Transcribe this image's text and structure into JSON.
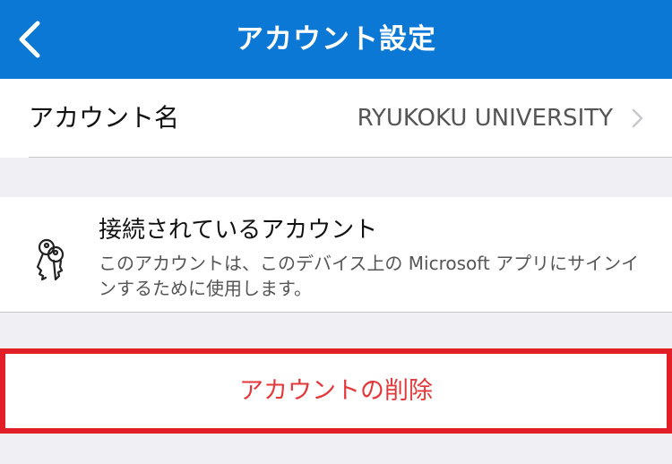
{
  "header": {
    "title": "アカウント設定",
    "back_icon": "chevron-left-icon"
  },
  "account_name_row": {
    "label": "アカウント名",
    "value": "RYUKOKU UNIVERSITY",
    "chevron_icon": "chevron-right-icon"
  },
  "connected_account": {
    "icon": "keys-icon",
    "title": "接続されているアカウント",
    "description": "このアカウントは、このデバイス上の Microsoft アプリにサインインするために使用します。"
  },
  "delete_account": {
    "label": "アカウントの削除",
    "highlight_color": "#e21f27",
    "label_color": "#e5383b"
  },
  "colors": {
    "header_bg": "#0a78d4",
    "background": "#efeff4"
  }
}
